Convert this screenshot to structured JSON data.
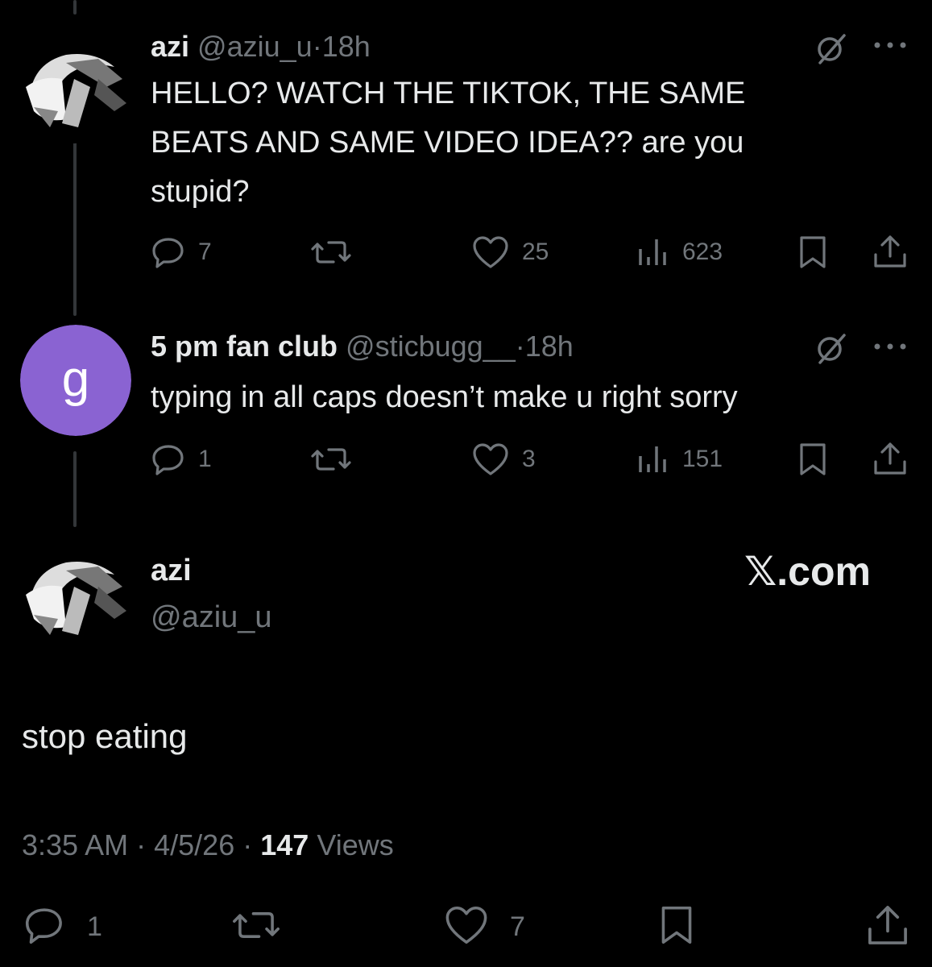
{
  "reply1": {
    "name": "azi",
    "handle": "@aziu_u",
    "dot": "·",
    "time": "18h",
    "text_line1": "HELLO? WATCH THE TIKTOK, THE SAME",
    "text_line2": "BEATS AND SAME VIDEO IDEA?? are you",
    "text_line3": "stupid?",
    "replies": "7",
    "likes": "25",
    "views": "623"
  },
  "reply2": {
    "avatar_letter": "g",
    "avatar_color": "#8a63d2",
    "name": "5 pm fan club",
    "handle": "@sticbugg__",
    "dot": "·",
    "time": "18h",
    "text": "typing in all caps doesn’t make u right sorry",
    "replies": "1",
    "likes": "3",
    "views": "151"
  },
  "main_post": {
    "name": "azi",
    "handle": "@aziu_u",
    "watermark": "𝕏.com",
    "text": "stop eating",
    "timestamp": "3:35 AM",
    "date": "4/5/26",
    "dot": "·",
    "views_count": "147",
    "views_label": "Views",
    "replies": "1",
    "likes": "7"
  },
  "colors": {
    "background": "#000000",
    "text": "#e7e9ea",
    "muted": "#71767b",
    "thread_line": "#333639"
  }
}
